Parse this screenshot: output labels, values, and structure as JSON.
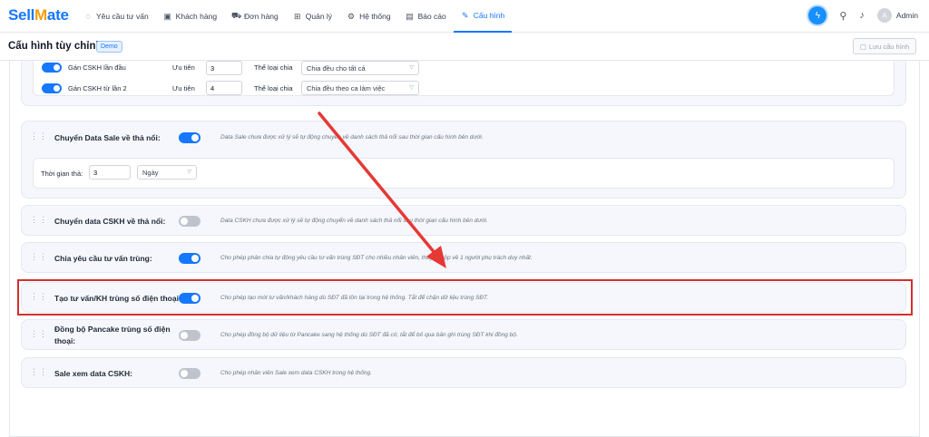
{
  "app": {
    "logo": {
      "part1": "Sell",
      "part2": "M",
      "part3": "ate"
    },
    "nav": [
      {
        "label": "Yêu cầu tư vấn",
        "icon": "chat-bubble-icon"
      },
      {
        "label": "Khách hàng",
        "icon": "contacts-card-icon"
      },
      {
        "label": "Đơn hàng",
        "icon": "cart-icon"
      },
      {
        "label": "Quản lý",
        "icon": "grid-icon"
      },
      {
        "label": "Hệ thống",
        "icon": "gear-icon"
      },
      {
        "label": "Báo cáo",
        "icon": "chart-icon"
      },
      {
        "label": "Cấu hình",
        "icon": "wrench-icon",
        "active": true
      }
    ],
    "user": {
      "avatar_letter": "A",
      "name": "Admin"
    }
  },
  "header": {
    "title": "Cấu hình tùy chỉnh",
    "badge": "Demo",
    "save_label": "Lưu cấu hình"
  },
  "assign_rows": [
    {
      "label": "Gán CSKH lần đầu",
      "priority_label": "Ưu tiên",
      "priority": "3",
      "type_label": "Thể loại chia",
      "type_value": "Chia đều cho tất cả"
    },
    {
      "label": "Gán CSKH từ lần 2",
      "priority_label": "Ưu tiên",
      "priority": "4",
      "type_label": "Thể loại chia",
      "type_value": "Chia đều theo ca làm việc"
    }
  ],
  "settings": [
    {
      "label": "Chuyển Data Sale về thả nổi:",
      "on": true,
      "desc": "Data Sale chưa được xử lý sẽ tự động chuyển về danh sách thả nổi sau thời gian cấu hình bên dưới.",
      "sub": {
        "label": "Thời gian thả:",
        "value": "3",
        "unit": "Ngày"
      }
    },
    {
      "label": "Chuyển data CSKH về thả nổi:",
      "on": false,
      "desc": "Data CSKH chưa được xử lý sẽ tự động chuyển về danh sách thả nổi sau thời gian cấu hình bên dưới."
    },
    {
      "label": "Chia yêu cầu tư vấn trùng:",
      "on": true,
      "desc": "Cho phép phân chia tự động yêu cầu tư vấn trùng SĐT cho nhiều nhân viên, thay vì gộp về 1 người phụ trách duy nhất."
    },
    {
      "label": "Tạo tư vấn/KH trùng số điện thoại:",
      "on": true,
      "desc": "Cho phép tạo mới tư vấn/khách hàng dù SĐT đã tồn tại trong hệ thống. Tắt để chặn dữ liệu trùng SĐT."
    },
    {
      "label_line1": "Đồng bộ Pancake trùng số điện",
      "label_line2": "thoại:",
      "on": false,
      "desc": "Cho phép đồng bộ dữ liệu từ Pancake sang hệ thống dù SĐT đã có; tắt để bỏ qua bản ghi trùng SĐT khi đồng bộ."
    },
    {
      "label": "Sale xem data CSKH:",
      "on": false,
      "desc": "Cho phép nhân viên Sale xem data CSKH trong hệ thống."
    }
  ],
  "colors": {
    "accent": "#1677ff",
    "highlight": "#d32f2f",
    "arrow": "#e53935"
  }
}
